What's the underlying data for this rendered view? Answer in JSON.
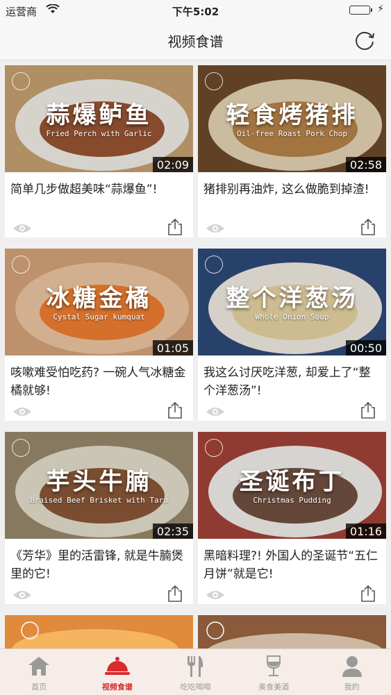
{
  "status": {
    "carrier": "运营商",
    "time": "下午5:02"
  },
  "nav": {
    "title": "视频食谱"
  },
  "videos": [
    {
      "title_overlay": "蒜爆鲈鱼",
      "subtitle_overlay": "Fried Perch with Garlic",
      "duration": "02:09",
      "description": "简单几步做超美味“蒜爆鱼”!",
      "bg": "#c9a374",
      "plate": "#f4f1ea",
      "food": "#8a3a14"
    },
    {
      "title_overlay": "轻食烤猪排",
      "subtitle_overlay": "Oil-free Roast Pork Chop",
      "duration": "02:58",
      "description": "猪排别再油炸, 这么做脆到掉渣!",
      "bg": "#6f4a2c",
      "plate": "#e9d6b6",
      "food": "#b07636"
    },
    {
      "title_overlay": "冰糖金橘",
      "subtitle_overlay": "Cystal Sugar kumquat",
      "duration": "01:05",
      "description": "咳嗽难受怕吃药? 一碗人气冰糖金橘就够!",
      "bg": "#d8a67c",
      "plate": "#f0c9a3",
      "food": "#f2731d"
    },
    {
      "title_overlay": "整个洋葱汤",
      "subtitle_overlay": "Whole Onion Soup",
      "duration": "00:50",
      "description": "我这么讨厌吃洋葱, 却爱上了“整个洋葱汤”!",
      "bg": "#2d4a7a",
      "plate": "#f3eee4",
      "food": "#e8d199"
    },
    {
      "title_overlay": "芋头牛腩",
      "subtitle_overlay": "Braised Beef Brisket with Taro",
      "duration": "02:35",
      "description": "《芳华》里的活雷锋, 就是牛腩煲里的它!",
      "bg": "#9a8a6e",
      "plate": "#e8e1d0",
      "food": "#7a3f1c"
    },
    {
      "title_overlay": "圣诞布丁",
      "subtitle_overlay": "Christmas Pudding",
      "duration": "01:16",
      "description": "黑暗料理?! 外国人的圣诞节“五仁月饼”就是它!",
      "bg": "#a44438",
      "plate": "#f4f2ee",
      "food": "#5a3522"
    }
  ],
  "tabs": [
    {
      "label": "首页",
      "icon": "home-icon"
    },
    {
      "label": "视频食谱",
      "icon": "cloche-icon"
    },
    {
      "label": "吃吃喝喝",
      "icon": "fork-knife-icon"
    },
    {
      "label": "美食美酒",
      "icon": "wine-glass-icon"
    },
    {
      "label": "我的",
      "icon": "user-icon"
    }
  ],
  "colors": {
    "accent": "#d92b2b",
    "tab_inactive": "#999999",
    "tabbar_bg": "#f6ede8"
  }
}
